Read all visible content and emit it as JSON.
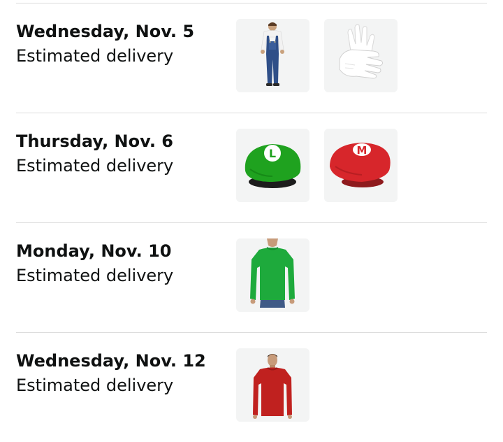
{
  "deliveries": [
    {
      "date": "Wednesday, Nov. 5",
      "status": "Estimated delivery",
      "items": [
        {
          "icon": "overalls-icon"
        },
        {
          "icon": "white-gloves-icon"
        }
      ]
    },
    {
      "date": "Thursday, Nov. 6",
      "status": "Estimated delivery",
      "items": [
        {
          "icon": "green-l-cap-icon",
          "emblem": "L",
          "color": "#1fa21f"
        },
        {
          "icon": "red-m-cap-icon",
          "emblem": "M",
          "color": "#d7262b"
        }
      ]
    },
    {
      "date": "Monday, Nov. 10",
      "status": "Estimated delivery",
      "items": [
        {
          "icon": "green-long-sleeve-shirt-icon",
          "color": "#1eaa3c"
        }
      ]
    },
    {
      "date": "Wednesday, Nov. 12",
      "status": "Estimated delivery",
      "items": [
        {
          "icon": "red-long-sleeve-shirt-icon",
          "color": "#c0211f"
        }
      ]
    }
  ]
}
